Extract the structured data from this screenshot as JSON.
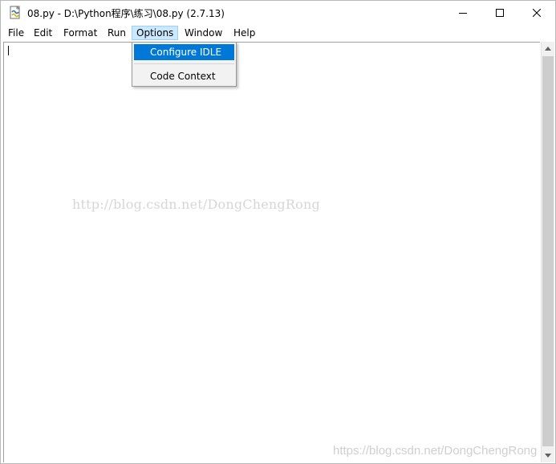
{
  "window": {
    "title": "08.py - D:\\Python程序\\练习\\08.py (2.7.13)",
    "minimize_icon": "minimize-icon",
    "maximize_icon": "maximize-icon",
    "close_icon": "close-icon"
  },
  "menubar": {
    "items": [
      {
        "label": "File"
      },
      {
        "label": "Edit"
      },
      {
        "label": "Format"
      },
      {
        "label": "Run"
      },
      {
        "label": "Options"
      },
      {
        "label": "Window"
      },
      {
        "label": "Help"
      }
    ],
    "active": "Options"
  },
  "options_menu": {
    "items": [
      {
        "label": "Configure IDLE",
        "highlighted": true
      },
      {
        "label": "Code Context",
        "highlighted": false
      }
    ]
  },
  "editor": {
    "content": ""
  },
  "watermarks": {
    "center": "http://blog.csdn.net/DongChengRong",
    "corner": "https://blog.csdn.net/DongChengRong"
  },
  "colors": {
    "highlight": "#0078d7",
    "menu_active_bg": "#cce8ff",
    "menu_active_border": "#99d1ff"
  }
}
